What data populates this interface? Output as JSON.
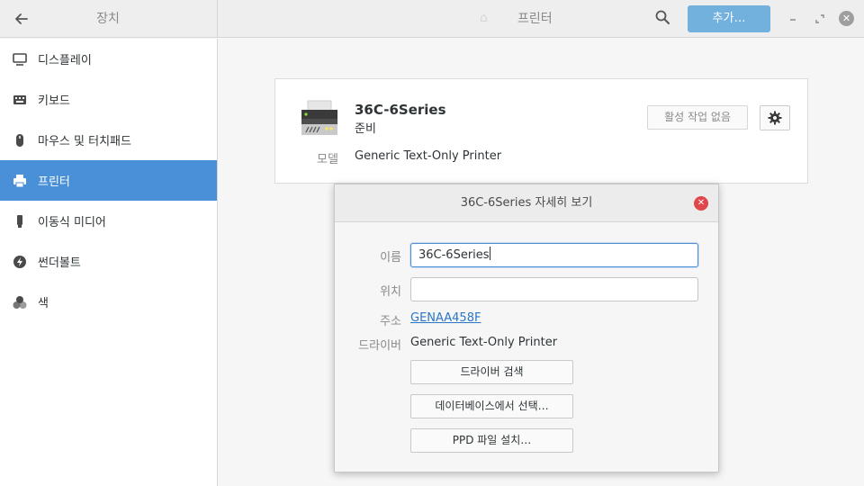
{
  "header": {
    "sidebar_title": "장치",
    "center_title": "프린터",
    "add_button": "추가…"
  },
  "sidebar": {
    "items": [
      {
        "label": "디스플레이",
        "icon": "display-icon"
      },
      {
        "label": "키보드",
        "icon": "keyboard-icon"
      },
      {
        "label": "마우스 및 터치패드",
        "icon": "mouse-icon"
      },
      {
        "label": "프린터",
        "icon": "printer-icon",
        "active": true
      },
      {
        "label": "이동식 미디어",
        "icon": "removable-media-icon"
      },
      {
        "label": "썬더볼트",
        "icon": "thunderbolt-icon"
      },
      {
        "label": "색",
        "icon": "color-icon"
      }
    ]
  },
  "printer": {
    "name": "36C-6Series",
    "status": "준비",
    "jobs_button": "활성 작업 없음",
    "model_label": "모델",
    "model_value": "Generic Text-Only Printer"
  },
  "dialog": {
    "title": "36C-6Series 자세히 보기",
    "name_label": "이름",
    "name_value": "36C-6Series",
    "location_label": "위치",
    "location_value": "",
    "address_label": "주소",
    "address_value": "GENAA458F",
    "driver_label": "드라이버",
    "driver_value": "Generic Text-Only Printer",
    "search_driver_button": "드라이버 검색",
    "select_db_button": "데이터베이스에서 선택…",
    "install_ppd_button": "PPD 파일 설치…"
  },
  "colors": {
    "accent": "#4a90d9",
    "add_button": "#72b1de",
    "dialog_close": "#e0474c",
    "link": "#2a76c6"
  }
}
